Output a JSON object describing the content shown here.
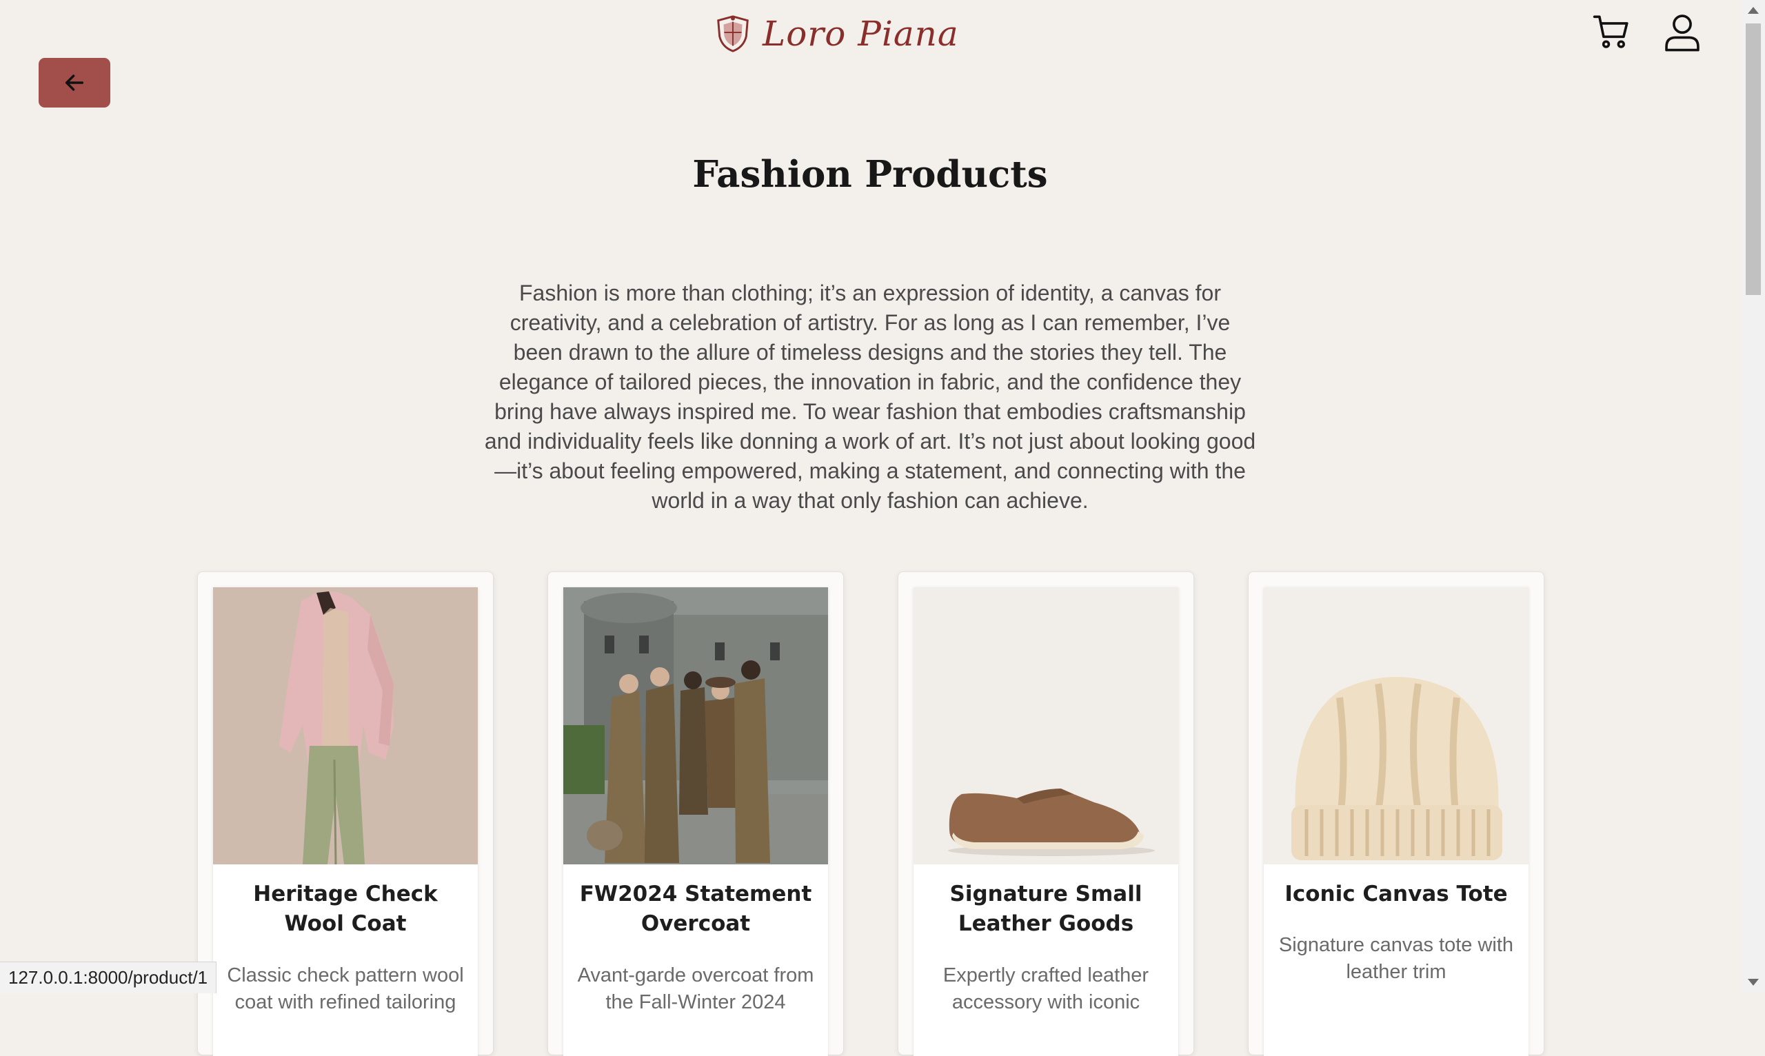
{
  "header": {
    "brand_name": "Loro Piana",
    "back_icon": "arrow-left-icon",
    "cart_icon": "cart-icon",
    "account_icon": "user-icon",
    "accent_color": "#a24f4b",
    "brand_color": "#8a2e2b"
  },
  "page": {
    "title": "Fashion Products",
    "intro": "Fashion is more than clothing; it’s an expression of identity, a canvas for creativity, and a celebration of artistry. For as long as I can remember, I’ve been drawn to the allure of timeless designs and the stories they tell. The elegance of tailored pieces, the innovation in fabric, and the confidence they bring have always inspired me. To wear fashion that embodies craftsmanship and individuality feels like donning a work of art. It’s not just about looking good—it’s about feeling empowered, making a statement, and connecting with the world in a way that only fashion can achieve."
  },
  "products": [
    {
      "title": "Heritage Check Wool Coat",
      "description": "Classic check pattern wool coat with refined tailoring",
      "image": "model-pink-jacket-image"
    },
    {
      "title": "FW2024 Statement Overcoat",
      "description": "Avant-garde overcoat from the Fall-Winter 2024",
      "image": "group-campaign-castle-image"
    },
    {
      "title": "Signature Small Leather Goods",
      "description": "Expertly crafted leather accessory with iconic",
      "image": "suede-loafer-image"
    },
    {
      "title": "Iconic Canvas Tote",
      "description": "Signature canvas tote with leather trim",
      "image": "cable-knit-beanie-image"
    }
  ],
  "status_bar": {
    "url": "127.0.0.1:8000/product/1"
  }
}
